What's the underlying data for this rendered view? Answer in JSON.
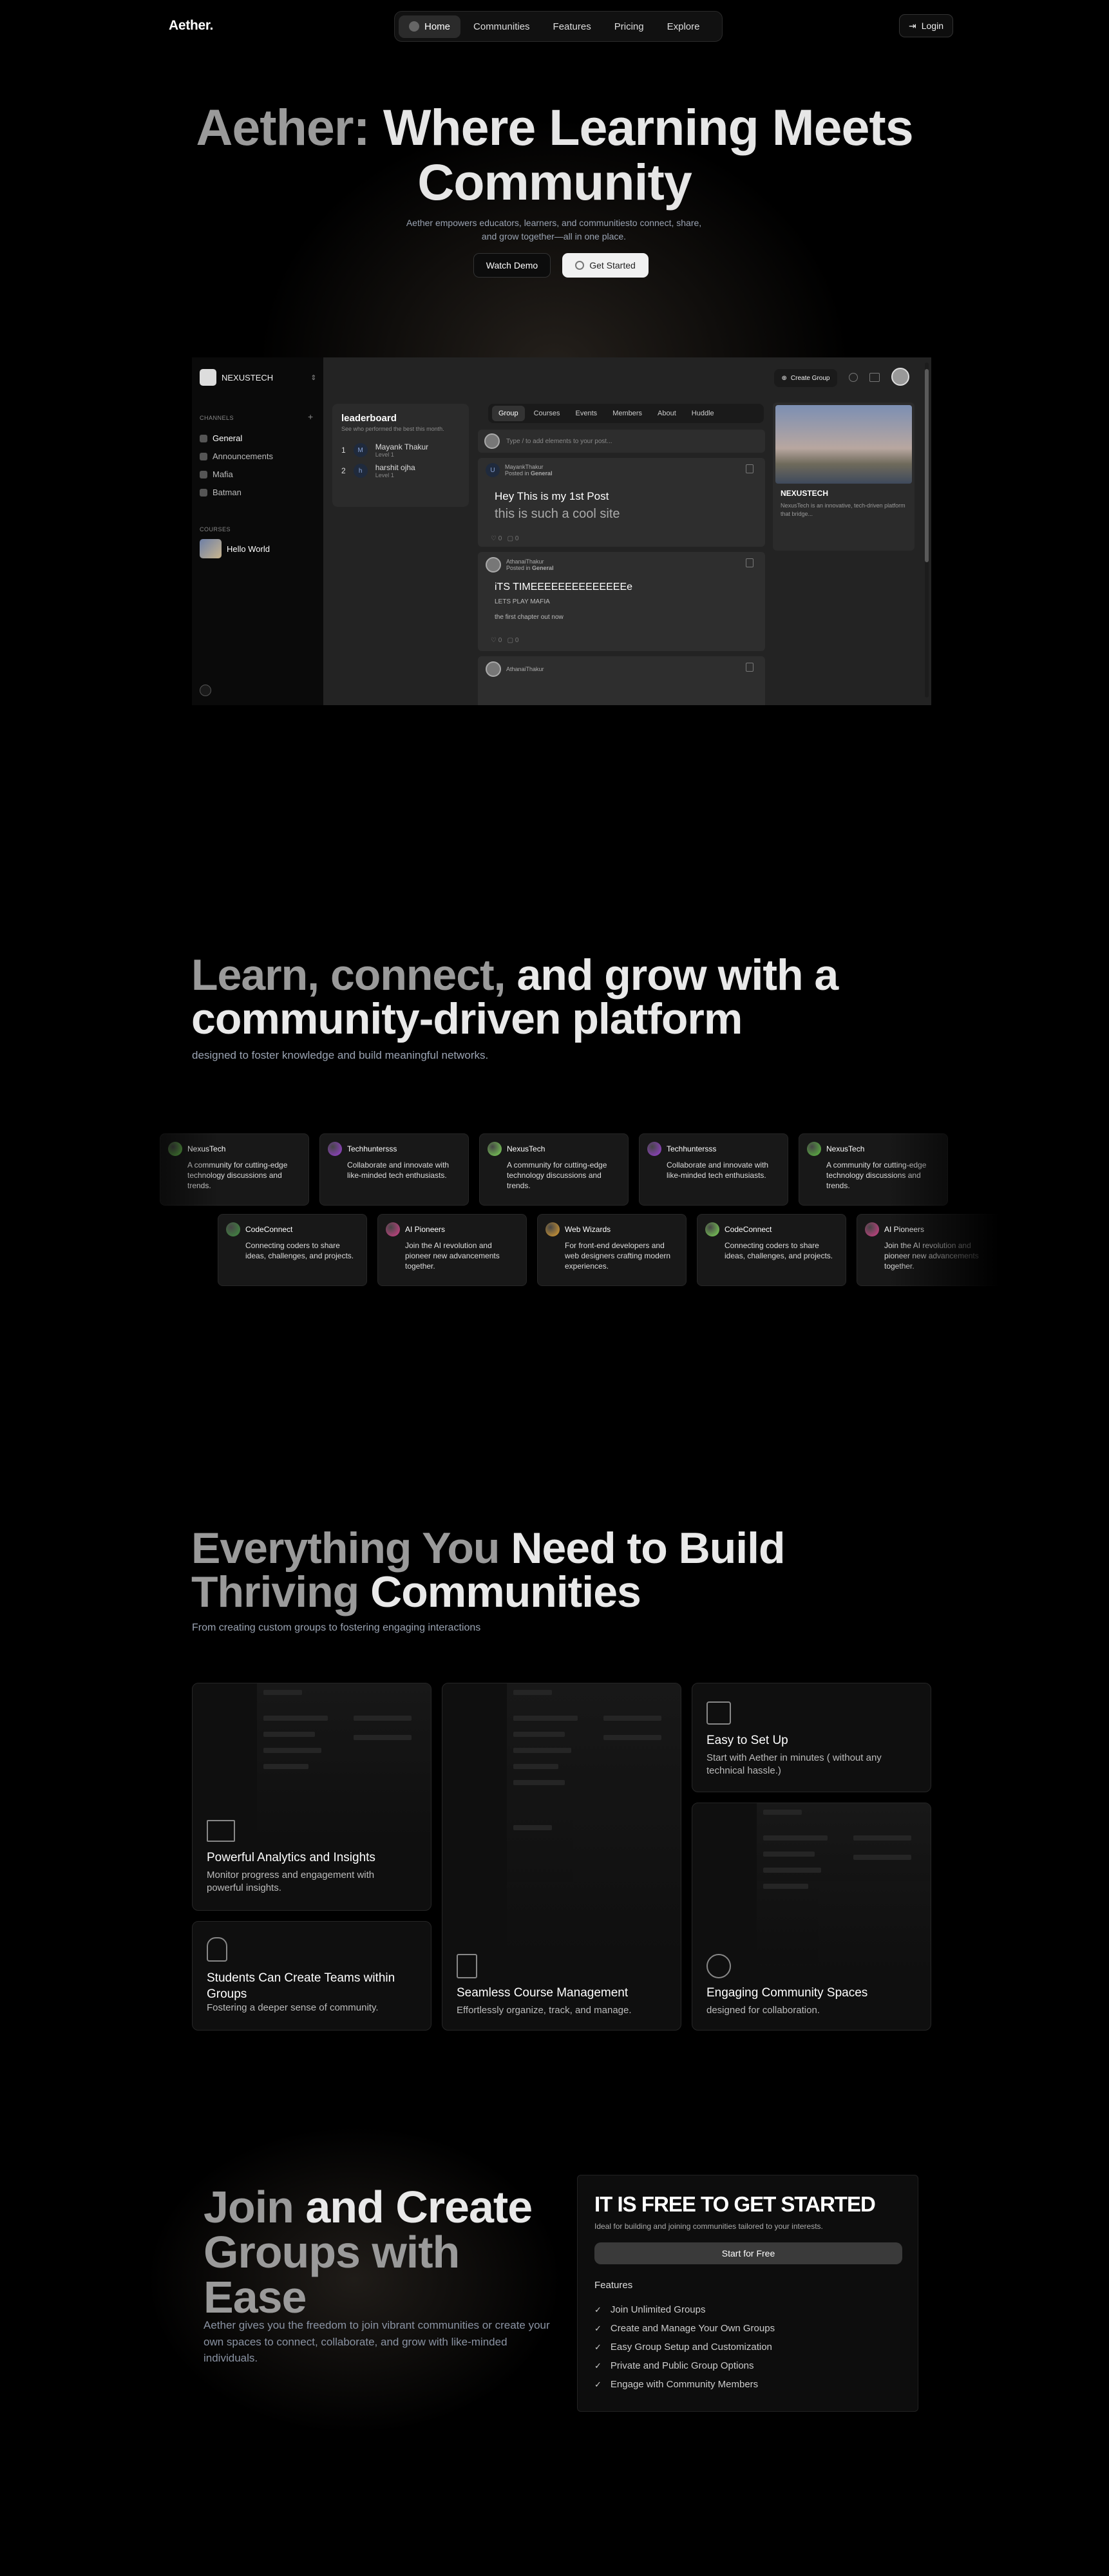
{
  "nav": {
    "brand": "Aether.",
    "items": [
      {
        "label": "Home",
        "active": true
      },
      {
        "label": "Communities"
      },
      {
        "label": "Features"
      },
      {
        "label": "Pricing"
      },
      {
        "label": "Explore"
      }
    ],
    "login": "Login"
  },
  "hero": {
    "title_dim": "Aether:",
    "title_bright": "Where Learning Meets",
    "title_line2": "Community",
    "subtitle_1": "Aether empowers educators, learners, and communitiesto connect, share,",
    "subtitle_2": "and grow together—all in one place.",
    "watch_demo": "Watch Demo",
    "get_started": "Get Started"
  },
  "dashboard": {
    "org": "NEXUSTECH",
    "channels_label": "CHANNELS",
    "channels": [
      "General",
      "Announcements",
      "Mafia",
      "Batman"
    ],
    "courses_label": "COURSES",
    "course": "Hello World",
    "leaderboard": {
      "title": "leaderboard",
      "subtitle": "See who performed the best this month.",
      "rows": [
        {
          "rank": "1",
          "initial": "M",
          "name": "Mayank Thakur",
          "level": "Level 1"
        },
        {
          "rank": "2",
          "initial": "h",
          "name": "harshit ojha",
          "level": "Level 1"
        }
      ]
    },
    "tabs": [
      "Group",
      "Courses",
      "Events",
      "Members",
      "About",
      "Huddle"
    ],
    "input_placeholder": "Type / to add elements to your post...",
    "posts": [
      {
        "author": "MayankThakur",
        "posted_in": "Posted in",
        "channel": "General",
        "title": "Hey This is my 1st Post",
        "body": "this is such a cool site",
        "likes": "0",
        "comments": "0"
      },
      {
        "author": "AthanaiThakur",
        "posted_in": "Posted in",
        "channel": "General",
        "title": "iTS TIMEEEEEEEEEEEEEEe",
        "line2": "LETS PLAY MAFIA",
        "line3": "the first chapter out now",
        "likes": "0",
        "comments": "0"
      },
      {
        "author": "AthanaiThakur"
      }
    ],
    "create_group": "Create Group",
    "side_card": {
      "title": "NEXUSTECH",
      "desc": "NexusTech is an innovative, tech-driven platform that bridge..."
    }
  },
  "section2": {
    "title_dim": "Learn, connect,",
    "title_bright": "and grow with a",
    "title_line2": "community-driven platform",
    "subtitle": "designed to foster knowledge and build meaningful networks.",
    "row1": [
      {
        "name": "NexusTech",
        "desc": "A community for cutting-edge technology discussions and trends.",
        "color": "#5cbf3f"
      },
      {
        "name": "Techhuntersss",
        "desc": "Collaborate and innovate with like-minded tech enthusiasts.",
        "color": "#9b3fd6"
      },
      {
        "name": "NexusTech",
        "desc": "A community for cutting-edge technology discussions and trends.",
        "color": "#7ed957"
      },
      {
        "name": "Techhuntersss",
        "desc": "Collaborate and innovate with like-minded tech enthusiasts.",
        "color": "#9b3fd6"
      },
      {
        "name": "NexusTech",
        "desc": "A community for cutting-edge technology discussions and trends.",
        "color": "#5cbf3f"
      }
    ],
    "row2": [
      {
        "name": "CodeConnect",
        "desc": "Connecting coders to share ideas, challenges, and projects.",
        "color": "#3f8f3f"
      },
      {
        "name": "AI Pioneers",
        "desc": "Join the AI revolution and pioneer new advancements together.",
        "color": "#d6408a"
      },
      {
        "name": "Web Wizards",
        "desc": "For front-end developers and web designers crafting modern experiences.",
        "color": "#e0a030"
      },
      {
        "name": "CodeConnect",
        "desc": "Connecting coders to share ideas, challenges, and projects.",
        "color": "#7ed957"
      },
      {
        "name": "AI Pioneers",
        "desc": "Join the AI revolution and pioneer new advancements together.",
        "color": "#d6408a"
      }
    ]
  },
  "section3": {
    "title_dim": "Everything You",
    "title_bright": "Need to Build",
    "title_line2_dim": "Thriving",
    "title_line2_bright": "Communities",
    "subtitle": "From creating custom groups to fostering engaging interactions",
    "features": [
      {
        "title": "Powerful Analytics and Insights",
        "desc": "Monitor progress and engagement with powerful insights."
      },
      {
        "title": "Students Can Create Teams within Groups",
        "desc": "Fostering a deeper sense of community."
      },
      {
        "title": "Seamless Course Management",
        "desc": "Effortlessly organize, track, and manage."
      },
      {
        "title": "Easy to Set Up",
        "desc": "Start with Aether in minutes ( without any technical hassle.)"
      },
      {
        "title": "Engaging Community Spaces",
        "desc": "designed for collaboration."
      }
    ]
  },
  "section4": {
    "title_line1_dim": "Join",
    "title_line1_bright": "and Create",
    "title_line2": "Groups with",
    "title_line3": "Ease",
    "desc": "Aether gives you the freedom to join vibrant communities or create your own spaces to connect, collaborate, and grow with like-minded individuals.",
    "pricing": {
      "heading": "IT IS FREE TO GET STARTED",
      "sub": "Ideal for building and joining communities tailored to your interests.",
      "cta": "Start for Free",
      "features_label": "Features",
      "features": [
        "Join Unlimited Groups",
        "Create and Manage Your Own Groups",
        "Easy Group Setup and Customization",
        "Private and Public Group Options",
        "Engage with Community Members"
      ]
    }
  }
}
